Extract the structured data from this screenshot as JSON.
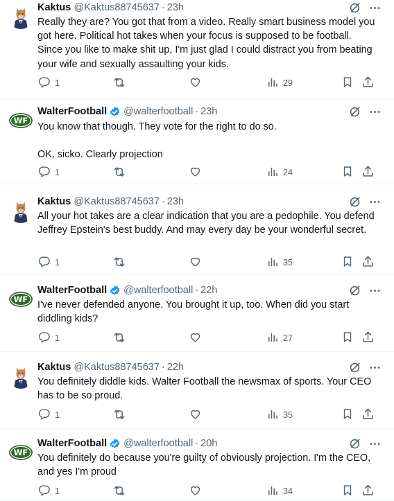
{
  "tweets": [
    {
      "author": "Kaktus",
      "handle": "@Kaktus88745637",
      "sep": "·",
      "time": "23h",
      "verified": false,
      "avatar": "kaktus",
      "text": "Really they are? You got that from a video. Really smart business model you got here. Political hot takes when your focus is supposed to be football. Since you like to make shit up, I'm just glad I could distract you from beating your wife and sexually assaulting your kids.",
      "replies": "1",
      "views": "29"
    },
    {
      "author": "WalterFootball",
      "handle": "@walterfootball",
      "sep": "·",
      "time": "23h",
      "verified": true,
      "avatar": "wf",
      "text": "You know that though. They vote for the right to do so.\n\nOK, sicko. Clearly projection",
      "replies": "1",
      "views": "24"
    },
    {
      "author": "Kaktus",
      "handle": "@Kaktus88745637",
      "sep": "·",
      "time": "23h",
      "verified": false,
      "avatar": "kaktus",
      "text": "All your hot takes are a clear indication that you are a pedophile. You defend Jeffrey Epstein's best buddy. And may every day be your wonderful secret.",
      "replies": "1",
      "views": "35"
    },
    {
      "author": "WalterFootball",
      "handle": "@walterfootball",
      "sep": "·",
      "time": "22h",
      "verified": true,
      "avatar": "wf",
      "text": "I've never defended anyone. You brought it up, too. When did you start diddling kids?",
      "replies": "1",
      "views": "27"
    },
    {
      "author": "Kaktus",
      "handle": "@Kaktus88745637",
      "sep": "·",
      "time": "22h",
      "verified": false,
      "avatar": "kaktus",
      "text": "You definitely diddle kids. Walter Football the newsmax of sports. Your CEO has to be so proud.",
      "replies": "1",
      "views": "35"
    },
    {
      "author": "WalterFootball",
      "handle": "@walterfootball",
      "sep": "·",
      "time": "20h",
      "verified": true,
      "avatar": "wf",
      "text": "You definitely do because you're guilty of obviously projection. I'm the CEO, and yes I'm proud",
      "replies": "1",
      "views": "34"
    }
  ],
  "colors": {
    "text": "#0f1419",
    "muted": "#536471",
    "verified": "#1d9bf0",
    "wf_green": "#2f6b2a"
  },
  "wf_logo_text": "WF"
}
